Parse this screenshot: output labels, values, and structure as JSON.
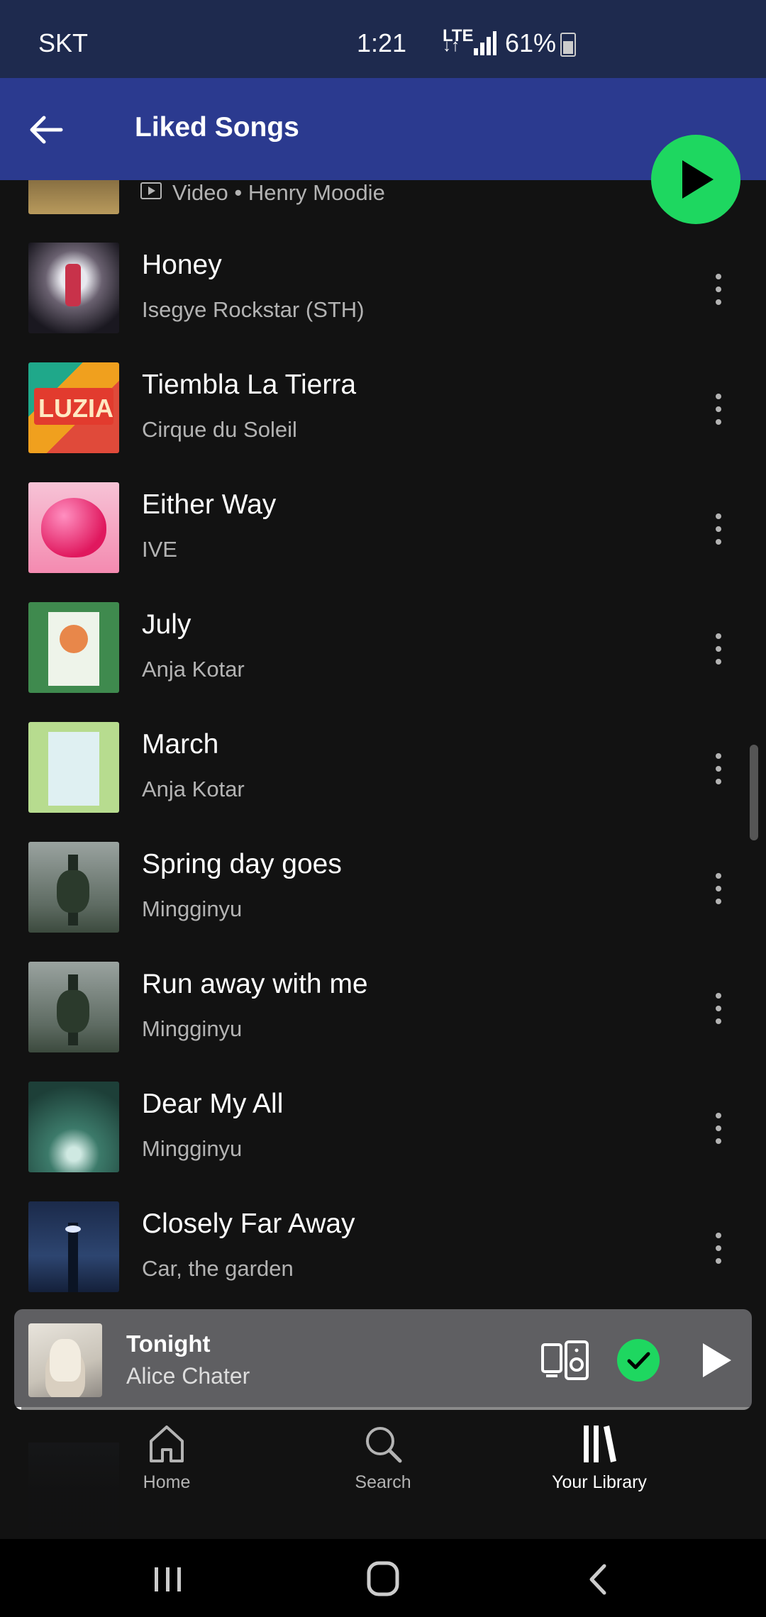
{
  "status_bar": {
    "carrier": "SKT",
    "time": "1:21",
    "network": "LTE",
    "battery": "61%"
  },
  "header": {
    "title": "Liked Songs"
  },
  "partial_item": {
    "type_label": "Video •",
    "artist": "Henry Moodie"
  },
  "songs": [
    {
      "title": "Honey",
      "artist": "Isegye Rockstar (STH)"
    },
    {
      "title": "Tiembla La Tierra",
      "artist": "Cirque du Soleil"
    },
    {
      "title": "Either Way",
      "artist": "IVE"
    },
    {
      "title": "July",
      "artist": "Anja Kotar"
    },
    {
      "title": "March",
      "artist": "Anja Kotar"
    },
    {
      "title": "Spring day goes",
      "artist": "Mingginyu"
    },
    {
      "title": "Run away with me",
      "artist": "Mingginyu"
    },
    {
      "title": "Dear My All",
      "artist": "Mingginyu"
    },
    {
      "title": "Closely Far Away",
      "artist": "Car, the garden"
    }
  ],
  "album_art_text": {
    "luzia": "LUZIA"
  },
  "mini_player": {
    "title": "Tonight",
    "artist": "Alice Chater",
    "progress": 0.01
  },
  "nav": {
    "home": "Home",
    "search": "Search",
    "library": "Your Library"
  },
  "colors": {
    "accent": "#1ed760",
    "header": "#2b3a8f",
    "background": "#121212"
  },
  "icons": {
    "back": "arrow-left-icon",
    "play": "play-icon",
    "more": "more-vertical-icon",
    "devices": "devices-icon",
    "liked": "check-icon"
  }
}
